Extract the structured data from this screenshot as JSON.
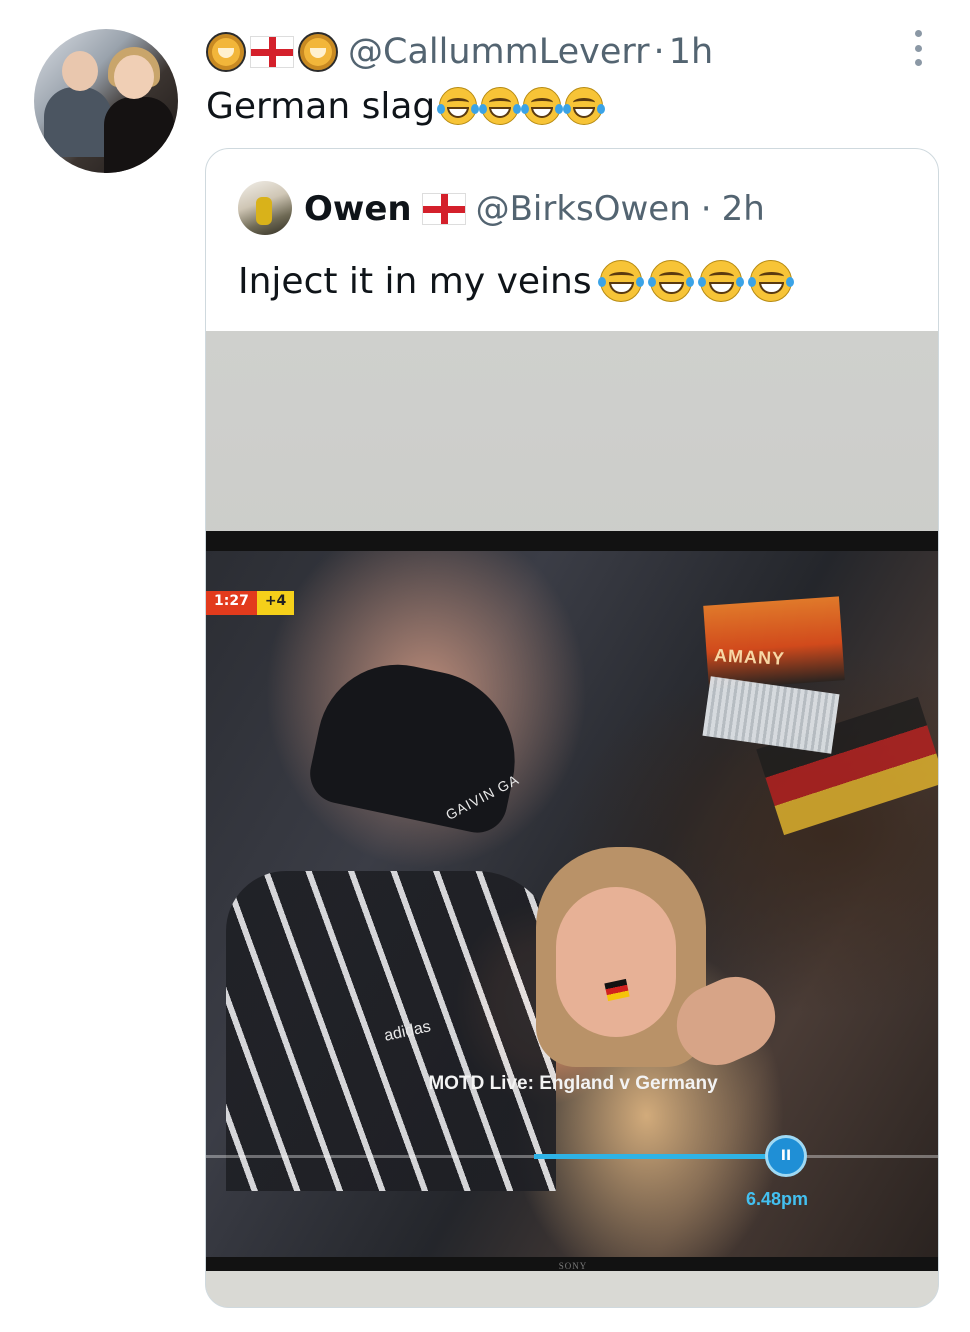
{
  "tweet": {
    "handle": "@CallummLeverr",
    "separator": "·",
    "time": "1h",
    "text": "German slag",
    "trailing_emoji_count": 4,
    "name_emoji": [
      "lion-face-icon",
      "england-flag-icon",
      "lion-face-icon"
    ]
  },
  "quoted": {
    "name": "Owen",
    "handle": "@BirksOwen",
    "separator": "·",
    "time": "2h",
    "text": "Inject it in my veins",
    "trailing_emoji_count": 4,
    "media": {
      "score_time": "1:27",
      "score_extra": "+4",
      "cap_text": "GAIVIN GA",
      "scarf_text": "AMANY",
      "brand_text": "adidas",
      "caption": "MOTD Live: England v Germany",
      "progress_fraction": 0.79,
      "progress_knob_label": "II",
      "progress_time": "6.48pm",
      "tv_brand": "SONY"
    }
  },
  "colors": {
    "text_primary": "#0f1419",
    "text_secondary": "#536471",
    "border": "#cfd9de",
    "progress_accent": "#2eb3e6"
  }
}
